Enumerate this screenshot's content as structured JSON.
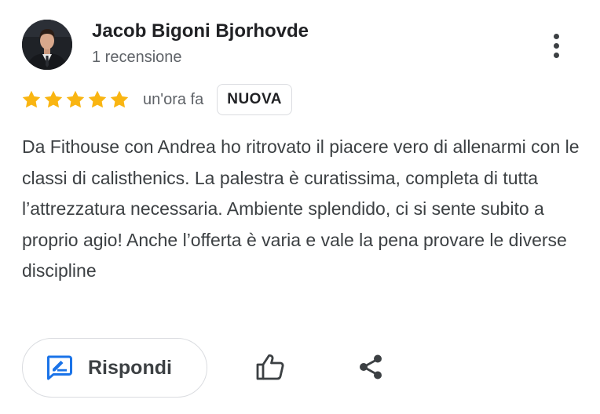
{
  "reviewer": {
    "name": "Jacob Bigoni Bjorhovde",
    "review_count": "1 recensione",
    "avatar_icon": "person-photo-avatar"
  },
  "review": {
    "rating": 5,
    "rating_max": 5,
    "time_ago": "un'ora fa",
    "badge": "NUOVA",
    "text": "Da Fithouse con Andrea ho ritrovato il piacere vero di allenarmi con le classi di calisthenics. La palestra è curatissima, completa di tutta l’attrezzatura necessaria. Ambiente splendido, ci si sente subito a proprio agio! Anche l’offerta è varia e vale la pena provare le diverse discipline"
  },
  "actions": {
    "reply_label": "Rispondi",
    "reply_icon": "reply-edit-icon",
    "like_icon": "thumbs-up-icon",
    "share_icon": "share-icon",
    "more_icon": "more-vert-icon"
  },
  "colors": {
    "star": "#f9b512",
    "reply_icon": "#1a73e8",
    "name": "#202124",
    "secondary_text": "#5f6368",
    "border": "#dadce0"
  }
}
